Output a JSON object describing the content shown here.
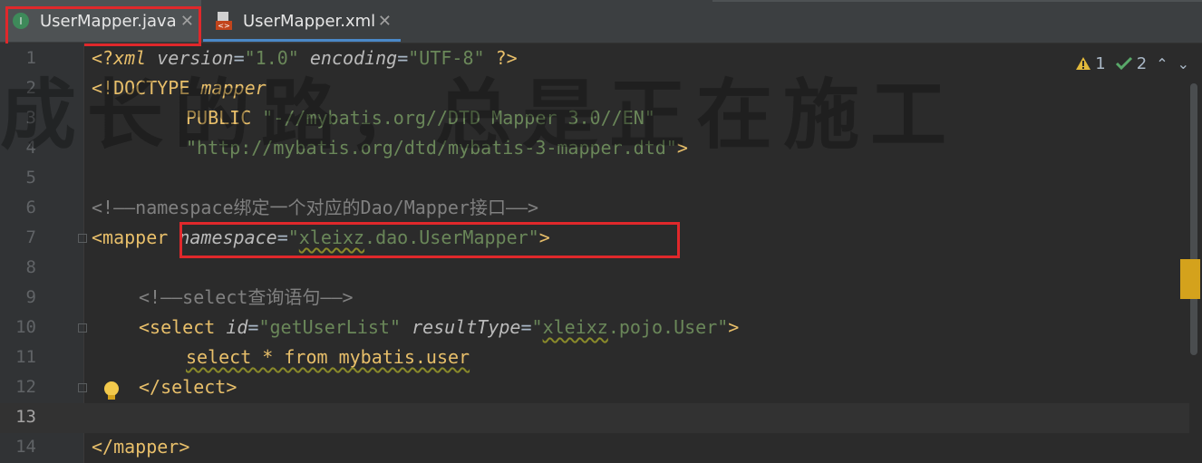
{
  "tabs": [
    {
      "label": "UserMapper.java",
      "icon": "interface-icon",
      "active": true
    },
    {
      "label": "UserMapper.xml",
      "icon": "xml-file-icon",
      "active": false
    }
  ],
  "close_glyph": "✕",
  "status": {
    "warnings": "1",
    "checks": "2"
  },
  "line_numbers": [
    "1",
    "2",
    "3",
    "4",
    "5",
    "6",
    "7",
    "8",
    "9",
    "10",
    "11",
    "12",
    "13",
    "14"
  ],
  "code": {
    "l1": {
      "open": "<?",
      "xml": "xml",
      "attr1": "version",
      "eq": "=",
      "val1": "\"1.0\"",
      "attr2": "encoding",
      "val2": "\"UTF-8\"",
      "close": " ?>"
    },
    "l2": {
      "text": "<!DOCTYPE ",
      "name": "mapper"
    },
    "l3": {
      "kw": "PUBLIC ",
      "str": "\"-//mybatis.org//DTD Mapper 3.0//EN\""
    },
    "l4": {
      "str": "\"http://mybatis.org/dtd/mybatis-3-mapper.dtd\"",
      "close": ">"
    },
    "l6": {
      "text": "<!——namespace绑定一个对应的Dao/Mapper接口——>"
    },
    "l7": {
      "open": "<mapper ",
      "attr": "namespace",
      "eq": "=",
      "q1": "\"",
      "v1": "xleixz",
      "v2": ".dao.UserMapper",
      "q2": "\"",
      "close": ">"
    },
    "l9": {
      "text": "<!——select查询语句——>"
    },
    "l10": {
      "open": "<select ",
      "attr1": "id",
      "eq": "=",
      "val1": "\"getUserList\"",
      "attr2": "resultType",
      "q1": "\"",
      "v1": "xleixz",
      "v2": ".pojo.User",
      "q2": "\"",
      "close": ">"
    },
    "l11": {
      "text": "select * from mybatis.user"
    },
    "l12": {
      "text": "</select>"
    },
    "l14": {
      "text": "</mapper>"
    }
  },
  "watermark": "成长的路，总是正在施工"
}
